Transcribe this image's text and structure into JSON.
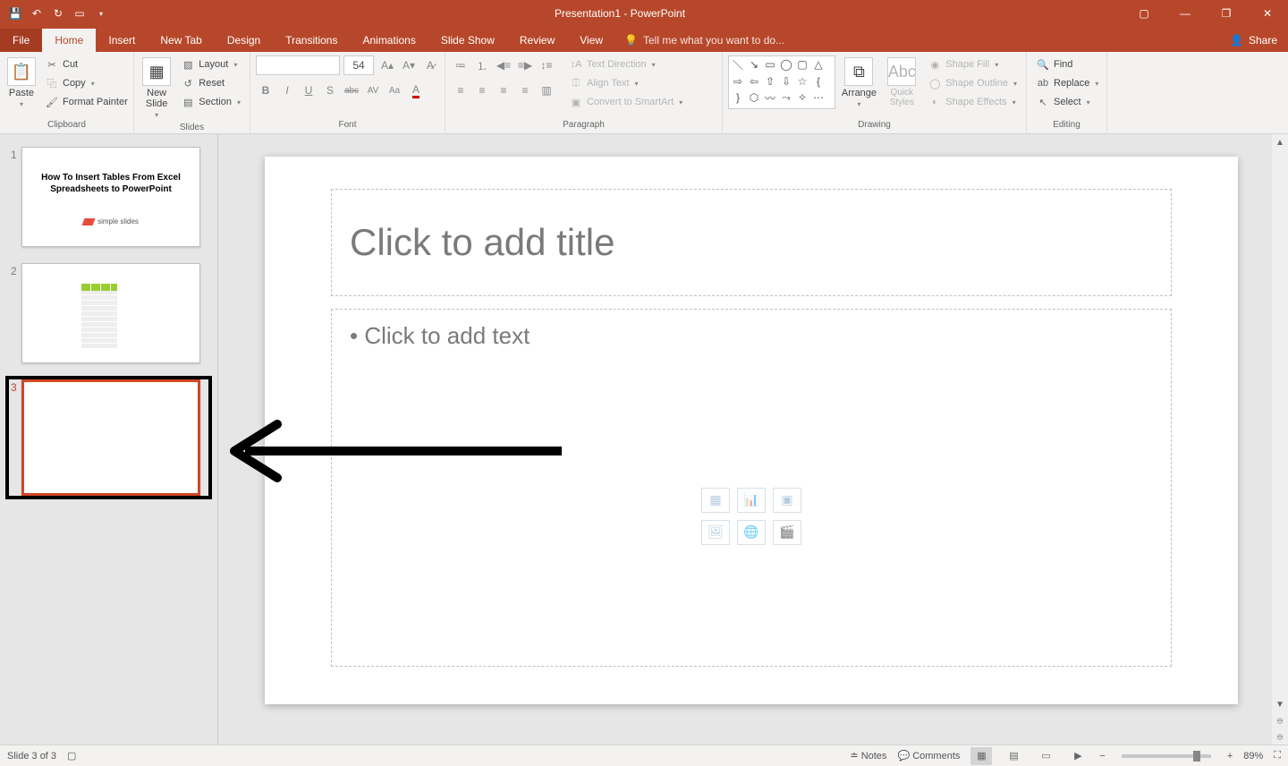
{
  "app": {
    "title": "Presentation1 - PowerPoint"
  },
  "qat": {
    "save": "save",
    "undo": "undo",
    "redo": "redo",
    "start": "start"
  },
  "tabs": {
    "file": "File",
    "home": "Home",
    "insert": "Insert",
    "newtab": "New Tab",
    "design": "Design",
    "transitions": "Transitions",
    "animations": "Animations",
    "slideshow": "Slide Show",
    "review": "Review",
    "view": "View",
    "tellme_placeholder": "Tell me what you want to do...",
    "share": "Share"
  },
  "ribbon": {
    "clipboard": {
      "label": "Clipboard",
      "paste": "Paste",
      "cut": "Cut",
      "copy": "Copy",
      "format_painter": "Format Painter"
    },
    "slides": {
      "label": "Slides",
      "new_slide": "New\nSlide",
      "layout": "Layout",
      "reset": "Reset",
      "section": "Section"
    },
    "font": {
      "label": "Font",
      "size": "54",
      "bold": "B",
      "italic": "I",
      "underline": "U",
      "shadow": "S",
      "strike": "abc",
      "spacing": "AV",
      "case": "Aa"
    },
    "paragraph": {
      "label": "Paragraph",
      "text_direction": "Text Direction",
      "align_text": "Align Text",
      "smartart": "Convert to SmartArt"
    },
    "drawing": {
      "label": "Drawing",
      "arrange": "Arrange",
      "quick_styles": "Quick\nStyles",
      "shape_fill": "Shape Fill",
      "shape_outline": "Shape Outline",
      "shape_effects": "Shape Effects"
    },
    "editing": {
      "label": "Editing",
      "find": "Find",
      "replace": "Replace",
      "select": "Select"
    }
  },
  "thumbs": {
    "s1": {
      "num": "1",
      "title": "How To Insert Tables From Excel Spreadsheets to PowerPoint",
      "brand": "simple slides"
    },
    "s2": {
      "num": "2"
    },
    "s3": {
      "num": "3"
    }
  },
  "slide": {
    "title_placeholder": "Click to add title",
    "body_placeholder": "• Click to add text"
  },
  "status": {
    "slide_info": "Slide 3 of 3",
    "notes": "Notes",
    "comments": "Comments",
    "zoom": "89%"
  }
}
